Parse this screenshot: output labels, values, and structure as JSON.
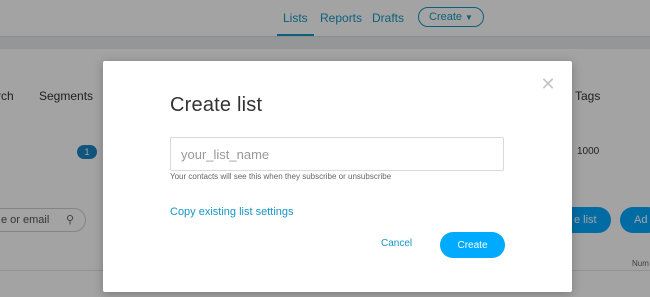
{
  "nav": {
    "tabs": [
      {
        "label": "Lists",
        "active": true
      },
      {
        "label": "Reports",
        "active": false
      },
      {
        "label": "Drafts",
        "active": false
      }
    ],
    "create_label": "Create",
    "create_icon": "chevron-down-icon"
  },
  "background": {
    "search_label": "rch",
    "segments_label": "Segments",
    "tags_label": "Tags",
    "page_badge": "1",
    "count_value": "1000",
    "search_placeholder": "e or email",
    "create_list_label": "e list",
    "add_label": "Ad",
    "number_header": "Num"
  },
  "modal": {
    "title": "Create list",
    "input": {
      "value": "",
      "placeholder": "your_list_name"
    },
    "helper": "Your contacts will see this when they subscribe or unsubscribe",
    "copy_link": "Copy existing list settings",
    "cancel_label": "Cancel",
    "create_label": "Create",
    "close_icon": "close-icon"
  },
  "colors": {
    "accent": "#1596c4",
    "primary_button": "#00aaff",
    "overlay": "rgba(0,0,0,0.36)"
  }
}
